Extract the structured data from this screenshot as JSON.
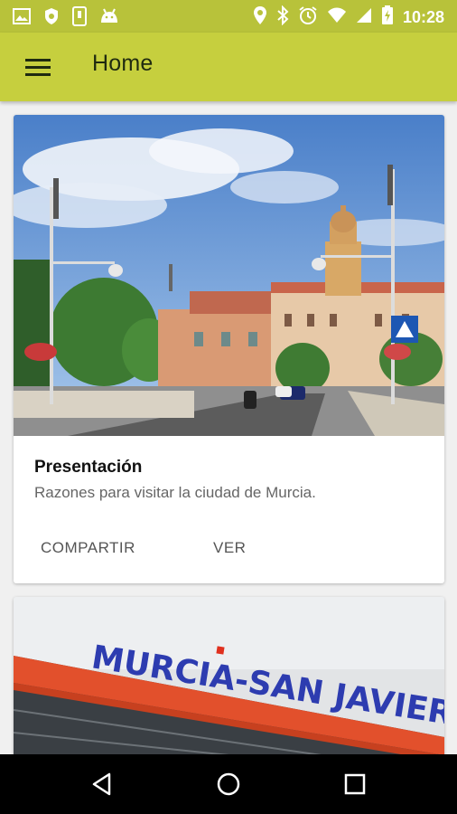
{
  "status_bar": {
    "time": "10:28",
    "icons": [
      "image-icon",
      "shield-icon",
      "phone-icon",
      "android-icon",
      "location-icon",
      "bluetooth-icon",
      "alarm-icon",
      "wifi-icon",
      "signal-icon",
      "battery-icon"
    ]
  },
  "app_bar": {
    "title": "Home",
    "menu_icon": "hamburger-menu-icon",
    "color": "#c6cf3e"
  },
  "cards": [
    {
      "image": "murcia-bridge-cathedral-photo",
      "title": "Presentación",
      "description": "Razones para visitar la ciudad de Murcia.",
      "actions": [
        "COMPARTIR",
        "VER"
      ]
    },
    {
      "image": "murcia-san-javier-airport-sign",
      "sign_text": "MURCIA-SAN JAVIER"
    }
  ],
  "nav_bar": {
    "buttons": [
      "back-icon",
      "home-icon",
      "recents-icon"
    ]
  }
}
